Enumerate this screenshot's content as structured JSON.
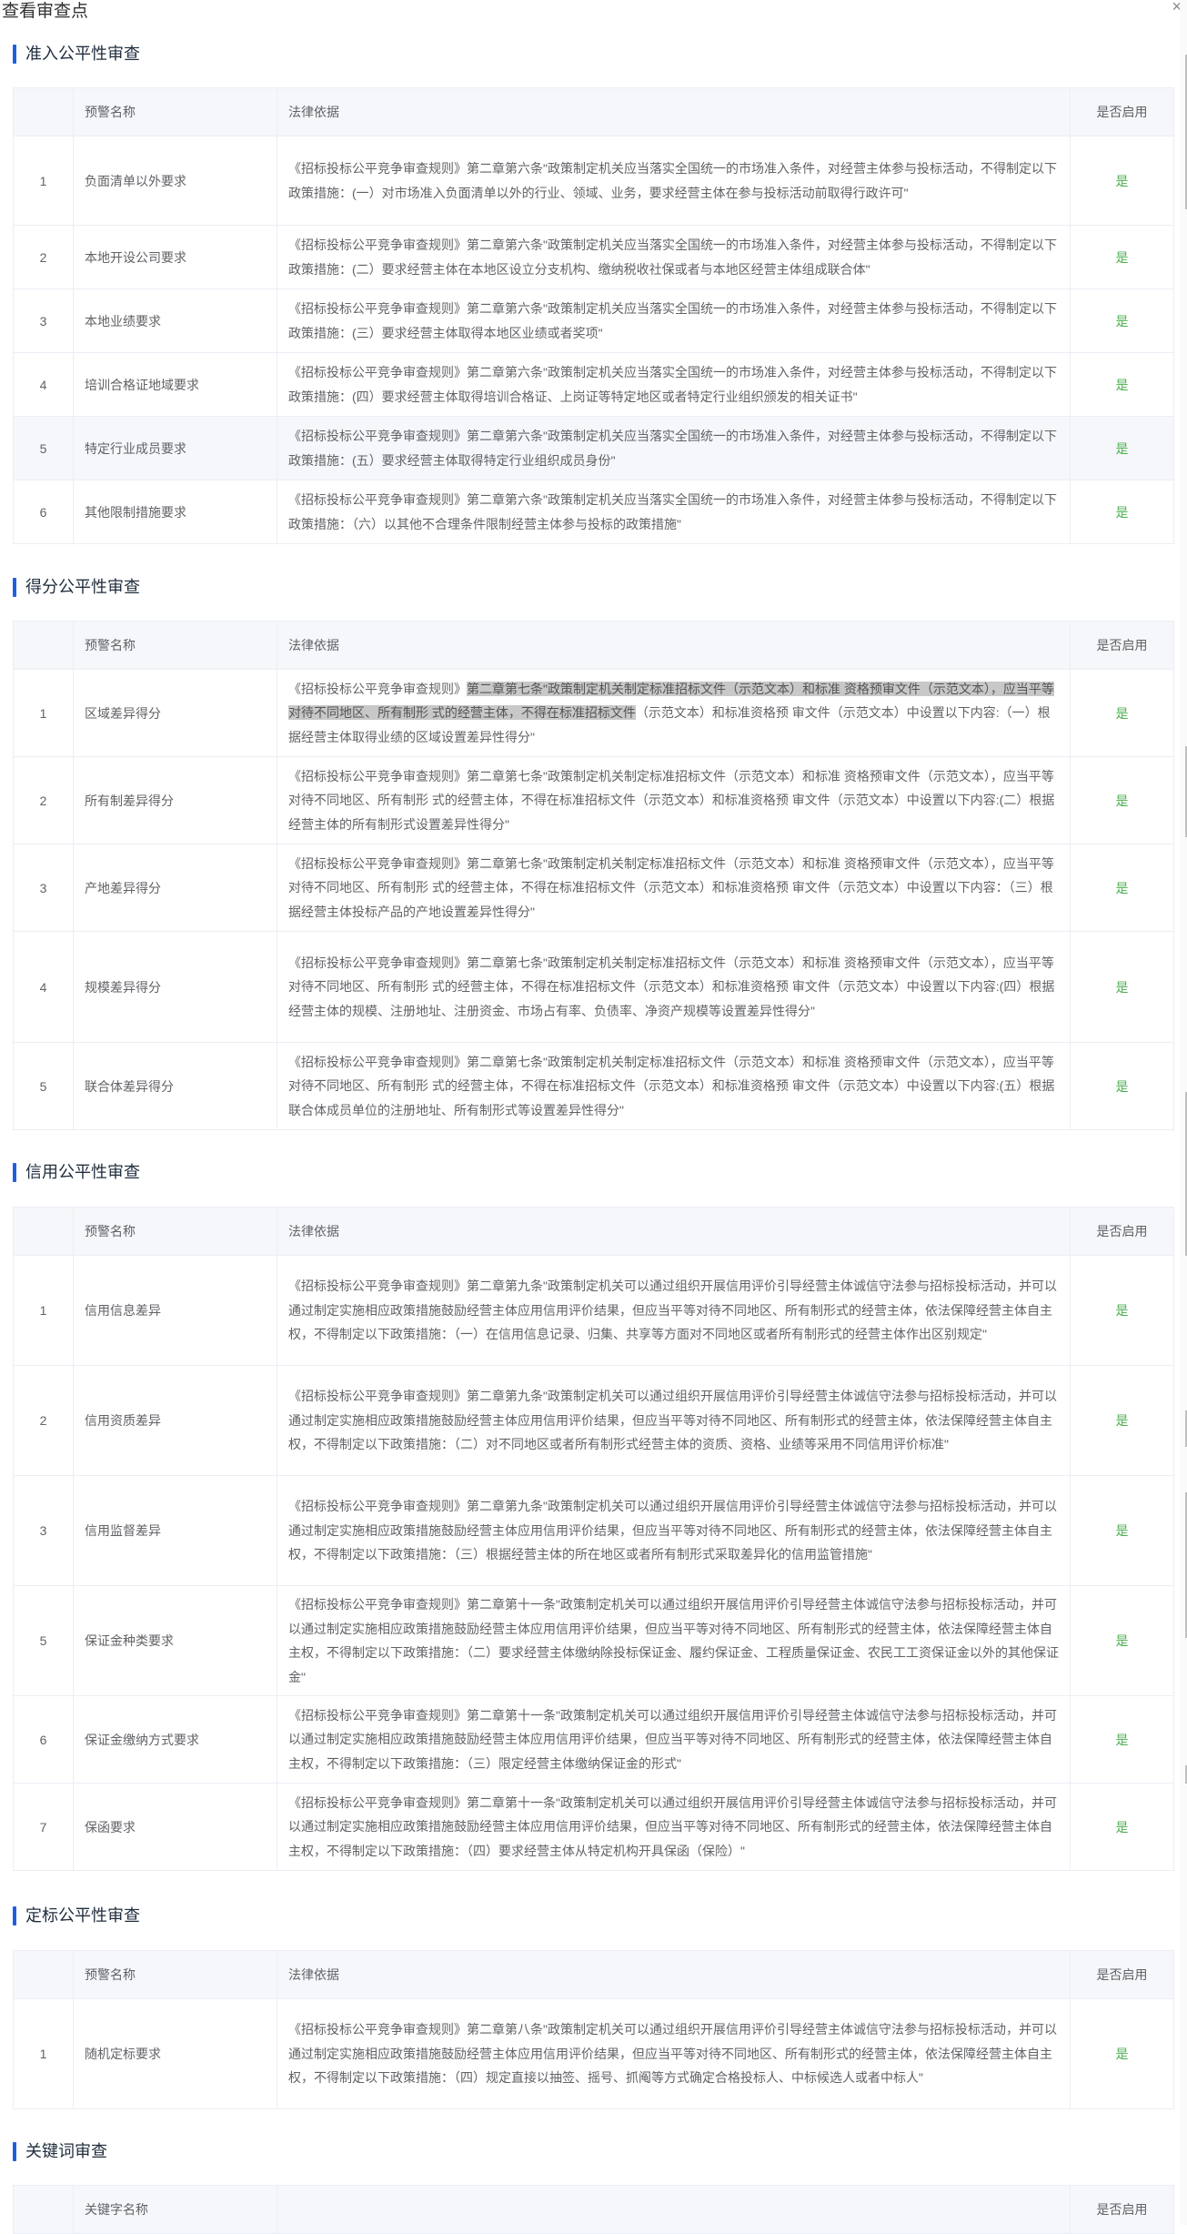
{
  "dialog": {
    "title": "查看审查点",
    "close_icon": "close-icon"
  },
  "columns": {
    "index": "",
    "name": "预警名称",
    "basis": "法律依据",
    "enabled": "是否启用",
    "keyword_name": "关键字名称"
  },
  "sections": [
    {
      "title": "准入公平性审查",
      "rows": [
        {
          "no": "1",
          "name": "负面清单以外要求",
          "basis": "《招标投标公平竞争审查规则》第二章第六条\"政策制定机关应当落实全国统一的市场准入条件，对经营主体参与投标活动，不得制定以下政策措施：(一）对市场准入负面清单以外的行业、领域、业务，要求经营主体在参与投标活动前取得行政许可\"",
          "enabled": "是"
        },
        {
          "no": "2",
          "name": "本地开设公司要求",
          "basis": "《招标投标公平竞争审查规则》第二章第六条\"政策制定机关应当落实全国统一的市场准入条件，对经营主体参与投标活动，不得制定以下政策措施：(二）要求经营主体在本地区设立分支机构、缴纳税收社保或者与本地区经营主体组成联合体\"",
          "enabled": "是"
        },
        {
          "no": "3",
          "name": "本地业绩要求",
          "basis": "《招标投标公平竞争审查规则》第二章第六条\"政策制定机关应当落实全国统一的市场准入条件，对经营主体参与投标活动，不得制定以下政策措施：(三）要求经营主体取得本地区业绩或者奖项\"",
          "enabled": "是"
        },
        {
          "no": "4",
          "name": "培训合格证地域要求",
          "basis": "《招标投标公平竞争审查规则》第二章第六条\"政策制定机关应当落实全国统一的市场准入条件，对经营主体参与投标活动，不得制定以下政策措施：(四）要求经营主体取得培训合格证、上岗证等特定地区或者特定行业组织颁发的相关证书\"",
          "enabled": "是"
        },
        {
          "no": "5",
          "name": "特定行业成员要求",
          "basis": "《招标投标公平竞争审查规则》第二章第六条\"政策制定机关应当落实全国统一的市场准入条件，对经营主体参与投标活动，不得制定以下政策措施：(五）要求经营主体取得特定行业组织成员身份\"",
          "enabled": "是"
        },
        {
          "no": "6",
          "name": "其他限制措施要求",
          "basis": "《招标投标公平竞争审查规则》第二章第六条\"政策制定机关应当落实全国统一的市场准入条件，对经营主体参与投标活动，不得制定以下政策措施：（六）以其他不合理条件限制经营主体参与投标的政策措施\"",
          "enabled": "是"
        }
      ]
    },
    {
      "title": "得分公平性审查",
      "rows": [
        {
          "no": "1",
          "name": "区域差异得分",
          "basis_pre": "《招标投标公平竞争审查规则》",
          "basis_sel": "第二章第七条\"政策制定机关制定标准招标文件（示范文本）和标准 资格预审文件（示范文本），应当平等对待不同地区、所有制形 式的经营主体，不得在标准招标文件",
          "basis_post": "（示范文本）和标准资格预 审文件（示范文本）中设置以下内容:（一）根据经营主体取得业绩的区域设置差异性得分\"",
          "enabled": "是"
        },
        {
          "no": "2",
          "name": "所有制差异得分",
          "basis": "《招标投标公平竞争审查规则》第二章第七条\"政策制定机关制定标准招标文件（示范文本）和标准 资格预审文件（示范文本），应当平等对待不同地区、所有制形 式的经营主体，不得在标准招标文件（示范文本）和标准资格预 审文件（示范文本）中设置以下内容:(二）根据经营主体的所有制形式设置差异性得分\"",
          "enabled": "是"
        },
        {
          "no": "3",
          "name": "产地差异得分",
          "basis": "《招标投标公平竞争审查规则》第二章第七条\"政策制定机关制定标准招标文件（示范文本）和标准 资格预审文件（示范文本），应当平等对待不同地区、所有制形 式的经营主体，不得在标准招标文件（示范文本）和标准资格预 审文件（示范文本）中设置以下内容：（三）根据经营主体投标产品的产地设置差异性得分\"",
          "enabled": "是"
        },
        {
          "no": "4",
          "name": "规模差异得分",
          "basis": "《招标投标公平竞争审查规则》第二章第七条\"政策制定机关制定标准招标文件（示范文本）和标准 资格预审文件（示范文本），应当平等对待不同地区、所有制形 式的经营主体，不得在标准招标文件（示范文本）和标准资格预 审文件（示范文本）中设置以下内容:(四）根据经营主体的规模、注册地址、注册资金、市场占有率、负债率、净资产规模等设置差异性得分\"",
          "enabled": "是"
        },
        {
          "no": "5",
          "name": "联合体差异得分",
          "basis": "《招标投标公平竞争审查规则》第二章第七条\"政策制定机关制定标准招标文件（示范文本）和标准 资格预审文件（示范文本），应当平等对待不同地区、所有制形 式的经营主体，不得在标准招标文件（示范文本）和标准资格预 审文件（示范文本）中设置以下内容:(五）根据联合体成员单位的注册地址、所有制形式等设置差异性得分\"",
          "enabled": "是"
        }
      ]
    },
    {
      "title": "信用公平性审查",
      "rows": [
        {
          "no": "1",
          "name": "信用信息差异",
          "basis": "《招标投标公平竞争审查规则》第二章第九条\"政策制定机关可以通过组织开展信用评价引导经营主体诚信守法参与招标投标活动，并可以通过制定实施相应政策措施鼓励经营主体应用信用评价结果，但应当平等对待不同地区、所有制形式的经营主体，依法保障经营主体自主权，不得制定以下政策措施：（一）在信用信息记录、归集、共享等方面对不同地区或者所有制形式的经营主体作出区别规定\"",
          "enabled": "是"
        },
        {
          "no": "2",
          "name": "信用资质差异",
          "basis": "《招标投标公平竞争审查规则》第二章第九条\"政策制定机关可以通过组织开展信用评价引导经营主体诚信守法参与招标投标活动，并可以通过制定实施相应政策措施鼓励经营主体应用信用评价结果，但应当平等对待不同地区、所有制形式的经营主体，依法保障经营主体自主权，不得制定以下政策措施：（二）对不同地区或者所有制形式经营主体的资质、资格、业绩等采用不同信用评价标准\"",
          "enabled": "是"
        },
        {
          "no": "3",
          "name": "信用监督差异",
          "basis": "《招标投标公平竞争审查规则》第二章第九条\"政策制定机关可以通过组织开展信用评价引导经营主体诚信守法参与招标投标活动，并可以通过制定实施相应政策措施鼓励经营主体应用信用评价结果，但应当平等对待不同地区、所有制形式的经营主体，依法保障经营主体自主权，不得制定以下政策措施：（三）根据经营主体的所在地区或者所有制形式采取差异化的信用监管措施\"",
          "enabled": "是"
        },
        {
          "no": "5",
          "name": "保证金种类要求",
          "basis": "《招标投标公平竞争审查规则》第二章第十一条\"政策制定机关可以通过组织开展信用评价引导经营主体诚信守法参与招标投标活动，并可以通过制定实施相应政策措施鼓励经营主体应用信用评价结果，但应当平等对待不同地区、所有制形式的经营主体，依法保障经营主体自主权，不得制定以下政策措施：（二）要求经营主体缴纳除投标保证金、履约保证金、工程质量保证金、农民工工资保证金以外的其他保证金\"",
          "enabled": "是"
        },
        {
          "no": "6",
          "name": "保证金缴纳方式要求",
          "basis": "《招标投标公平竞争审查规则》第二章第十一条\"政策制定机关可以通过组织开展信用评价引导经营主体诚信守法参与招标投标活动，并可以通过制定实施相应政策措施鼓励经营主体应用信用评价结果，但应当平等对待不同地区、所有制形式的经营主体，依法保障经营主体自主权，不得制定以下政策措施：（三）限定经营主体缴纳保证金的形式\"",
          "enabled": "是"
        },
        {
          "no": "7",
          "name": "保函要求",
          "basis": "《招标投标公平竞争审查规则》第二章第十一条\"政策制定机关可以通过组织开展信用评价引导经营主体诚信守法参与招标投标活动，并可以通过制定实施相应政策措施鼓励经营主体应用信用评价结果，但应当平等对待不同地区、所有制形式的经营主体，依法保障经营主体自主权，不得制定以下政策措施：（四）要求经营主体从特定机构开具保函（保险）\"",
          "enabled": "是"
        }
      ]
    },
    {
      "title": "定标公平性审查",
      "rows": [
        {
          "no": "1",
          "name": "随机定标要求",
          "basis": "《招标投标公平竞争审查规则》第二章第八条\"政策制定机关可以通过组织开展信用评价引导经营主体诚信守法参与招标投标活动，并可以通过制定实施相应政策措施鼓励经营主体应用信用评价结果，但应当平等对待不同地区、所有制形式的经营主体，依法保障经营主体自主权，不得制定以下政策措施：（四）规定直接以抽签、摇号、抓阄等方式确定合格投标人、中标候选人或者中标人\"",
          "enabled": "是"
        }
      ]
    },
    {
      "title": "关键词审查",
      "rows": []
    }
  ]
}
